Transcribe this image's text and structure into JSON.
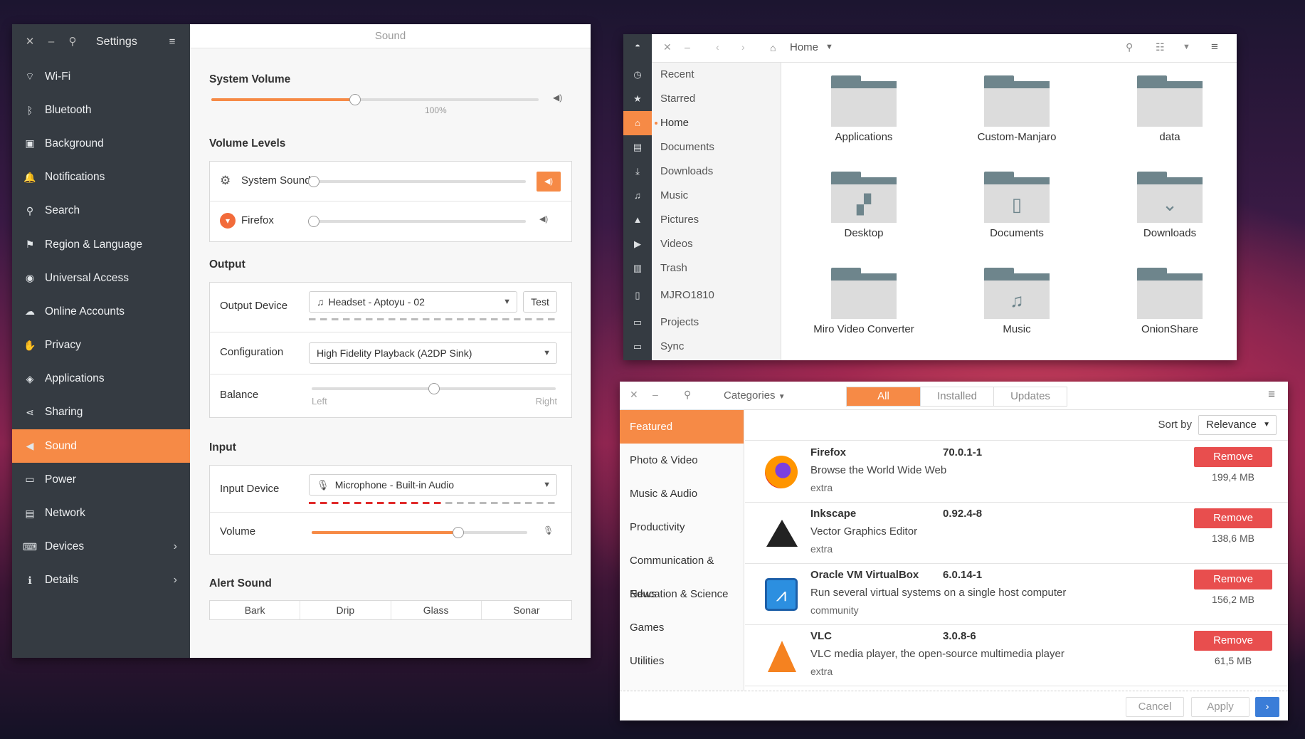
{
  "settings": {
    "title": "Settings",
    "panel_title": "Sound",
    "nav": [
      {
        "label": "Wi-Fi",
        "icon": "wifi-icon",
        "glyph": "⌔"
      },
      {
        "label": "Bluetooth",
        "icon": "bluetooth-icon",
        "glyph": "ᛒ"
      },
      {
        "label": "Background",
        "icon": "background-icon",
        "glyph": "▣"
      },
      {
        "label": "Notifications",
        "icon": "bell-icon",
        "glyph": "🔔"
      },
      {
        "label": "Search",
        "icon": "search-icon",
        "glyph": "⚲"
      },
      {
        "label": "Region & Language",
        "icon": "flag-icon",
        "glyph": "⚑"
      },
      {
        "label": "Universal Access",
        "icon": "accessibility-icon",
        "glyph": "◉"
      },
      {
        "label": "Online Accounts",
        "icon": "cloud-icon",
        "glyph": "☁"
      },
      {
        "label": "Privacy",
        "icon": "hand-icon",
        "glyph": "✋"
      },
      {
        "label": "Applications",
        "icon": "applications-icon",
        "glyph": "◈"
      },
      {
        "label": "Sharing",
        "icon": "share-icon",
        "glyph": "⋖"
      },
      {
        "label": "Sound",
        "icon": "speaker-icon",
        "glyph": "◀"
      },
      {
        "label": "Power",
        "icon": "power-icon",
        "glyph": "▭"
      },
      {
        "label": "Network",
        "icon": "network-icon",
        "glyph": "▤"
      },
      {
        "label": "Devices",
        "icon": "devices-icon",
        "glyph": "⌨"
      },
      {
        "label": "Details",
        "icon": "info-icon",
        "glyph": "ℹ"
      }
    ],
    "active_nav": "Sound",
    "system_volume": {
      "heading": "System Volume",
      "value_label": "100%",
      "level": 0.44
    },
    "volume_levels": {
      "heading": "Volume Levels",
      "system_sounds": "System Sounds",
      "firefox": "Firefox",
      "system_sounds_level": 0,
      "firefox_level": 0
    },
    "output": {
      "heading": "Output",
      "device_label": "Output Device",
      "device_value": "Headset - Aptoyu  -  02",
      "test_button": "Test",
      "configuration_label": "Configuration",
      "configuration_value": "High Fidelity Playback (A2DP Sink)",
      "balance_label": "Balance",
      "balance_left": "Left",
      "balance_right": "Right",
      "balance_level": 0.5
    },
    "input": {
      "heading": "Input",
      "device_label": "Input Device",
      "device_value": "Microphone - Built-in Audio",
      "volume_label": "Volume",
      "volume_level": 0.68,
      "input_meter_level": 0.55
    },
    "alert": {
      "heading": "Alert Sound",
      "options": [
        "Bark",
        "Drip",
        "Glass",
        "Sonar"
      ]
    }
  },
  "files": {
    "location": "Home",
    "places": [
      "Recent",
      "Starred",
      "Home",
      "Documents",
      "Downloads",
      "Music",
      "Pictures",
      "Videos",
      "Trash",
      "MJRO1810",
      "Projects",
      "Sync"
    ],
    "active_place": "Home",
    "folders": [
      "Applications",
      "Custom-Manjaro",
      "data",
      "Desktop",
      "Documents",
      "Downloads",
      "Miro Video Converter",
      "Music",
      "OnionShare"
    ]
  },
  "software": {
    "categories_label": "Categories",
    "tabs": [
      "All",
      "Installed",
      "Updates"
    ],
    "active_tab": "All",
    "side": [
      "Featured",
      "Photo & Video",
      "Music & Audio",
      "Productivity",
      "Communication & News",
      "Education & Science",
      "Games",
      "Utilities"
    ],
    "active_side": "Featured",
    "sort_label": "Sort by",
    "sort_value": "Relevance",
    "apps": [
      {
        "name": "Firefox",
        "version": "70.0.1-1",
        "desc": "Browse the World Wide Web",
        "repo": "extra",
        "action": "Remove",
        "size": "199,4 MB"
      },
      {
        "name": "Inkscape",
        "version": "0.92.4-8",
        "desc": "Vector Graphics Editor",
        "repo": "extra",
        "action": "Remove",
        "size": "138,6 MB"
      },
      {
        "name": "Oracle VM VirtualBox",
        "version": "6.0.14-1",
        "desc": "Run several virtual systems on a single host computer",
        "repo": "community",
        "action": "Remove",
        "size": "156,2 MB"
      },
      {
        "name": "VLC",
        "version": "3.0.8-6",
        "desc": "VLC media player, the open-source multimedia player",
        "repo": "extra",
        "action": "Remove",
        "size": "61,5 MB"
      }
    ],
    "cancel": "Cancel",
    "apply": "Apply"
  },
  "colors": {
    "accent": "#f68a46",
    "danger": "#e84e4e",
    "sidebar": "#353b42",
    "folder": "#6e858c"
  }
}
